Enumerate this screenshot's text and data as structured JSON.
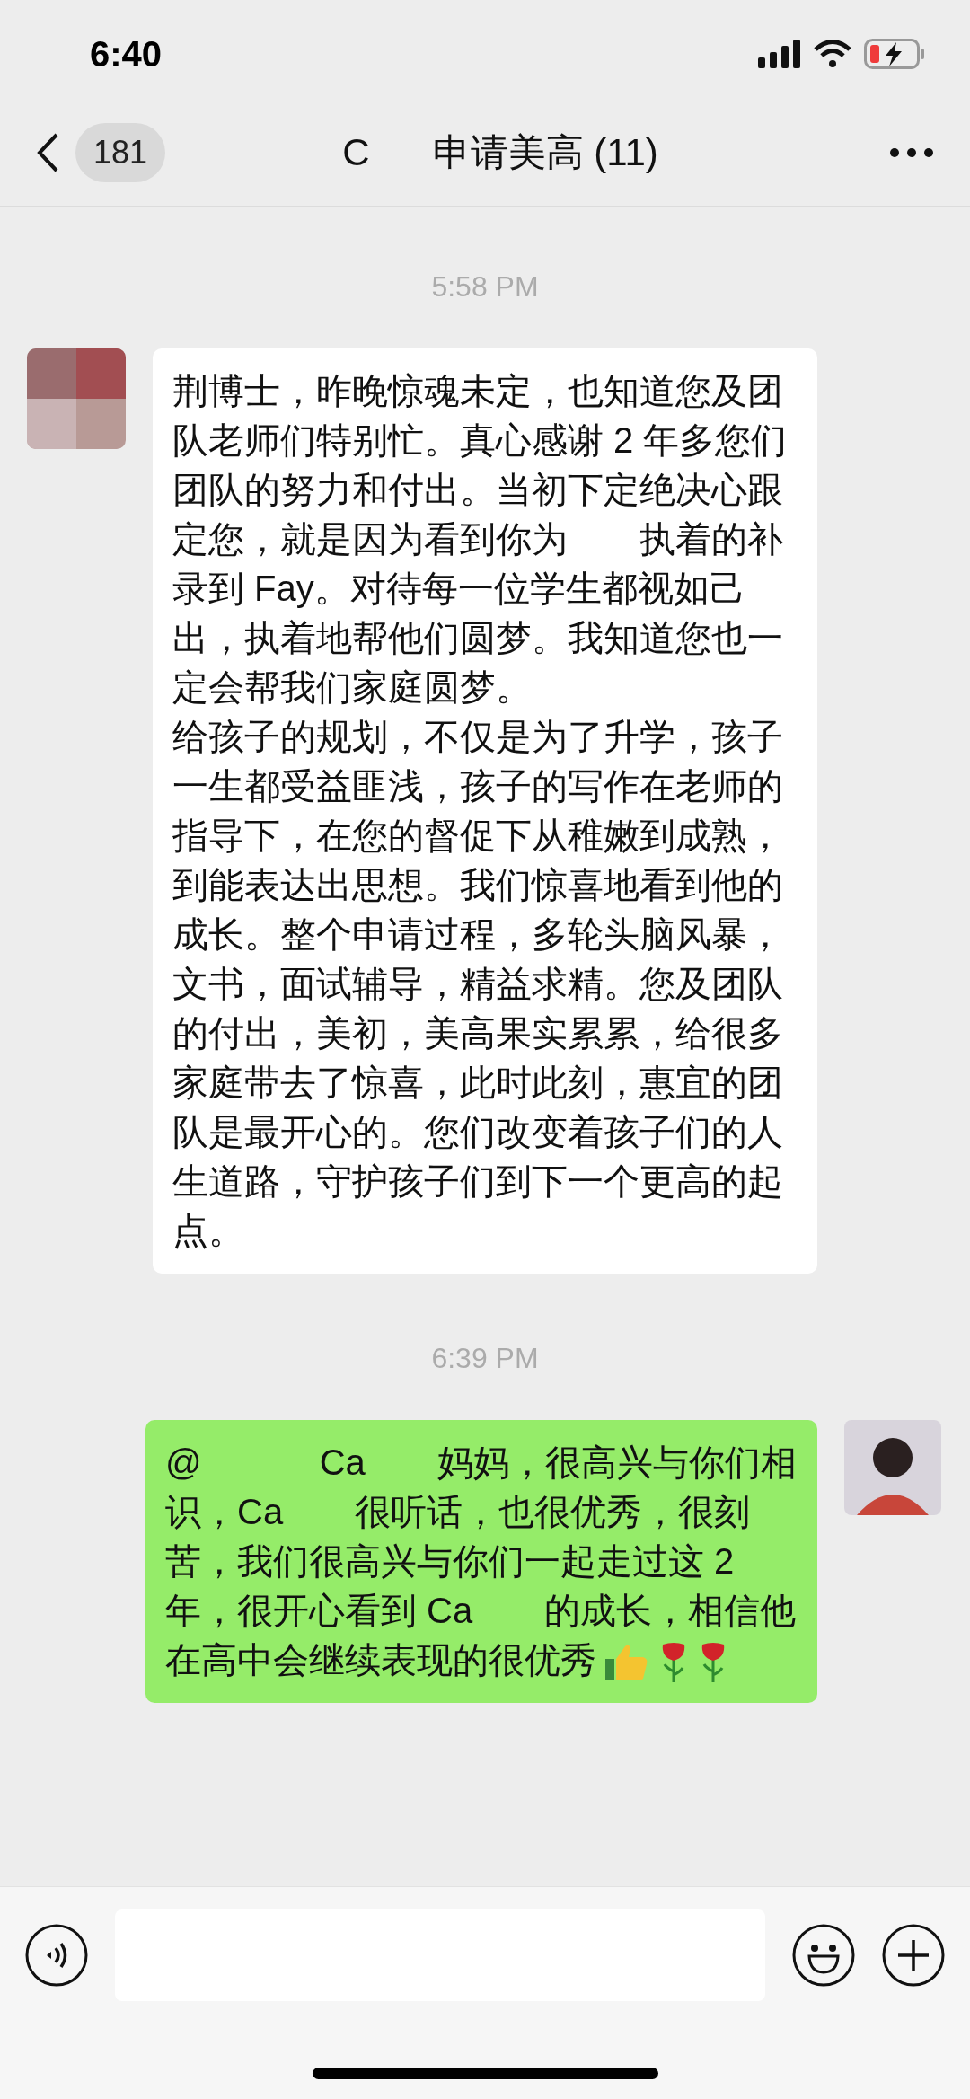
{
  "status_bar": {
    "time": "6:40"
  },
  "header": {
    "back_count": "181",
    "title_start": "C",
    "title_end": "申请美高 (11)"
  },
  "messages": [
    {
      "kind": "time",
      "text": "5:58 PM"
    },
    {
      "kind": "incoming",
      "paragraphs": [
        "荆博士，昨晚惊魂未定，也知道您及团队老师们特别忙。真心感谢 2 年多您们团队的努力和付出。当初下定绝决心跟定您，就是因为看到你为　　执着的补录到 Fay。对待每一位学生都视如己出，执着地帮他们圆梦。我知道您也一定会帮我们家庭圆梦。",
        "给孩子的规划，不仅是为了升学，孩子一生都受益匪浅，孩子的写作在老师的指导下，在您的督促下从稚嫩到成熟，到能表达出思想。我们惊喜地看到他的成长。整个申请过程，多轮头脑风暴，文书，面试辅导，精益求精。您及团队的付出，美初，美高果实累累，给很多家庭带去了惊喜，此时此刻，惠宜的团队是最开心的。您们改变着孩子们的人生道路，守护孩子们到下一个更高的起点。"
      ]
    },
    {
      "kind": "time",
      "text": "6:39 PM"
    },
    {
      "kind": "outgoing",
      "text": "@　　　 Ca　　妈妈，很高兴与你们相识，Ca　　很听话，也很优秀，很刻苦，我们很高兴与你们一起走过这 2 年，很开心看到 Ca　　的成长，相信他在高中会继续表现的很优秀",
      "emoji": [
        {
          "kind": "thumbs_up"
        },
        {
          "kind": "rose"
        },
        {
          "kind": "rose"
        }
      ]
    }
  ]
}
